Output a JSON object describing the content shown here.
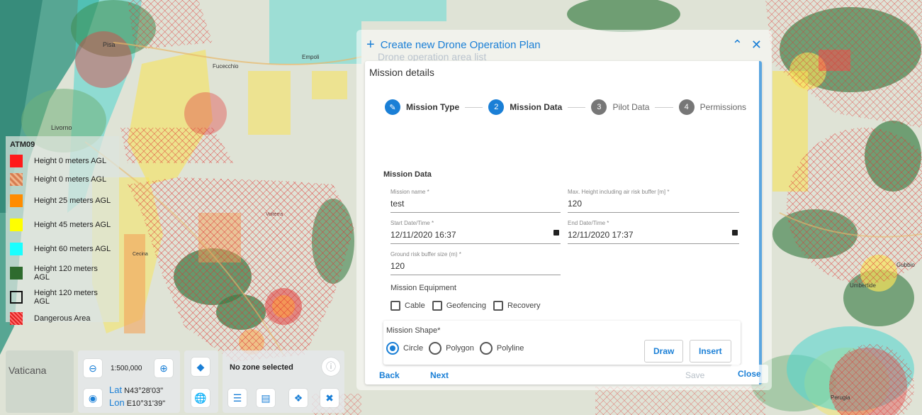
{
  "legend": {
    "title": "ATM09",
    "items": [
      {
        "label": "Height 0 meters AGL",
        "swatch": "solid",
        "color": "#ff1a1a"
      },
      {
        "label": "Height 0 meters AGL",
        "swatch": "hatched",
        "color": "#d67d52"
      },
      {
        "label": "Height 25 meters AGL",
        "swatch": "solid",
        "color": "#ff8c00"
      },
      {
        "label": "Height 45 meters AGL",
        "swatch": "solid",
        "color": "#ffff00"
      },
      {
        "label": "Height 60 meters AGL",
        "swatch": "solid",
        "color": "#1affff"
      },
      {
        "label": "Height 120 meters AGL",
        "swatch": "solid",
        "color": "#2e6b2e"
      },
      {
        "label": "Height 120 meters AGL",
        "swatch": "outline",
        "color": "#111111"
      },
      {
        "label": "Dangerous Area",
        "swatch": "danger",
        "color": "#e02020"
      }
    ]
  },
  "map_labels": {
    "pisa": "Pisa",
    "livorno": "Livorno",
    "fucecchio": "Fucecchio",
    "empoli": "Empoli",
    "vaticana": "Vaticana",
    "perugia": "Perugia",
    "umbertide": "Umbertide",
    "gubbio": "Gubbio",
    "volterra": "Volterra",
    "cecina": "Cecina"
  },
  "dialog": {
    "title": "Create new Drone Operation Plan",
    "ghost_title": "Drone operation area list",
    "panel_title": "Mission details",
    "steps": [
      {
        "num": "",
        "label": "Mission Type",
        "state": "done"
      },
      {
        "num": "2",
        "label": "Mission Data",
        "state": "active"
      },
      {
        "num": "3",
        "label": "Pilot Data",
        "state": "pending"
      },
      {
        "num": "4",
        "label": "Permissions",
        "state": "pending"
      }
    ],
    "section_title": "Mission Data",
    "fields": {
      "mission_name": {
        "label": "Mission name *",
        "value": "test"
      },
      "max_height": {
        "label": "Max. Height including air risk buffer [m] *",
        "value": "120"
      },
      "start": {
        "label": "Start Date/Time *",
        "value": "12/11/2020 16:37"
      },
      "end": {
        "label": "End Date/Time *",
        "value": "12/11/2020 17:37"
      },
      "ground_buffer": {
        "label": "Ground risk buffer size (m) *",
        "value": "120"
      }
    },
    "equipment_title": "Mission Equipment",
    "equipment": [
      "Cable",
      "Geofencing",
      "Recovery"
    ],
    "shape_title": "Mission Shape*",
    "shapes": [
      {
        "label": "Circle",
        "selected": true
      },
      {
        "label": "Polygon",
        "selected": false
      },
      {
        "label": "Polyline",
        "selected": false
      }
    ],
    "draw_label": "Draw",
    "insert_label": "Insert",
    "footer": {
      "back": "Back",
      "next": "Next",
      "save": "Save",
      "close": "Close"
    }
  },
  "controls": {
    "scale": "1:500,000",
    "lat_key": "Lat",
    "lat": "N43°28'03\"",
    "lon_key": "Lon",
    "lon": "E10°31'39\"",
    "zone": "No zone selected"
  },
  "colors": {
    "accent": "#1a7fd6"
  }
}
